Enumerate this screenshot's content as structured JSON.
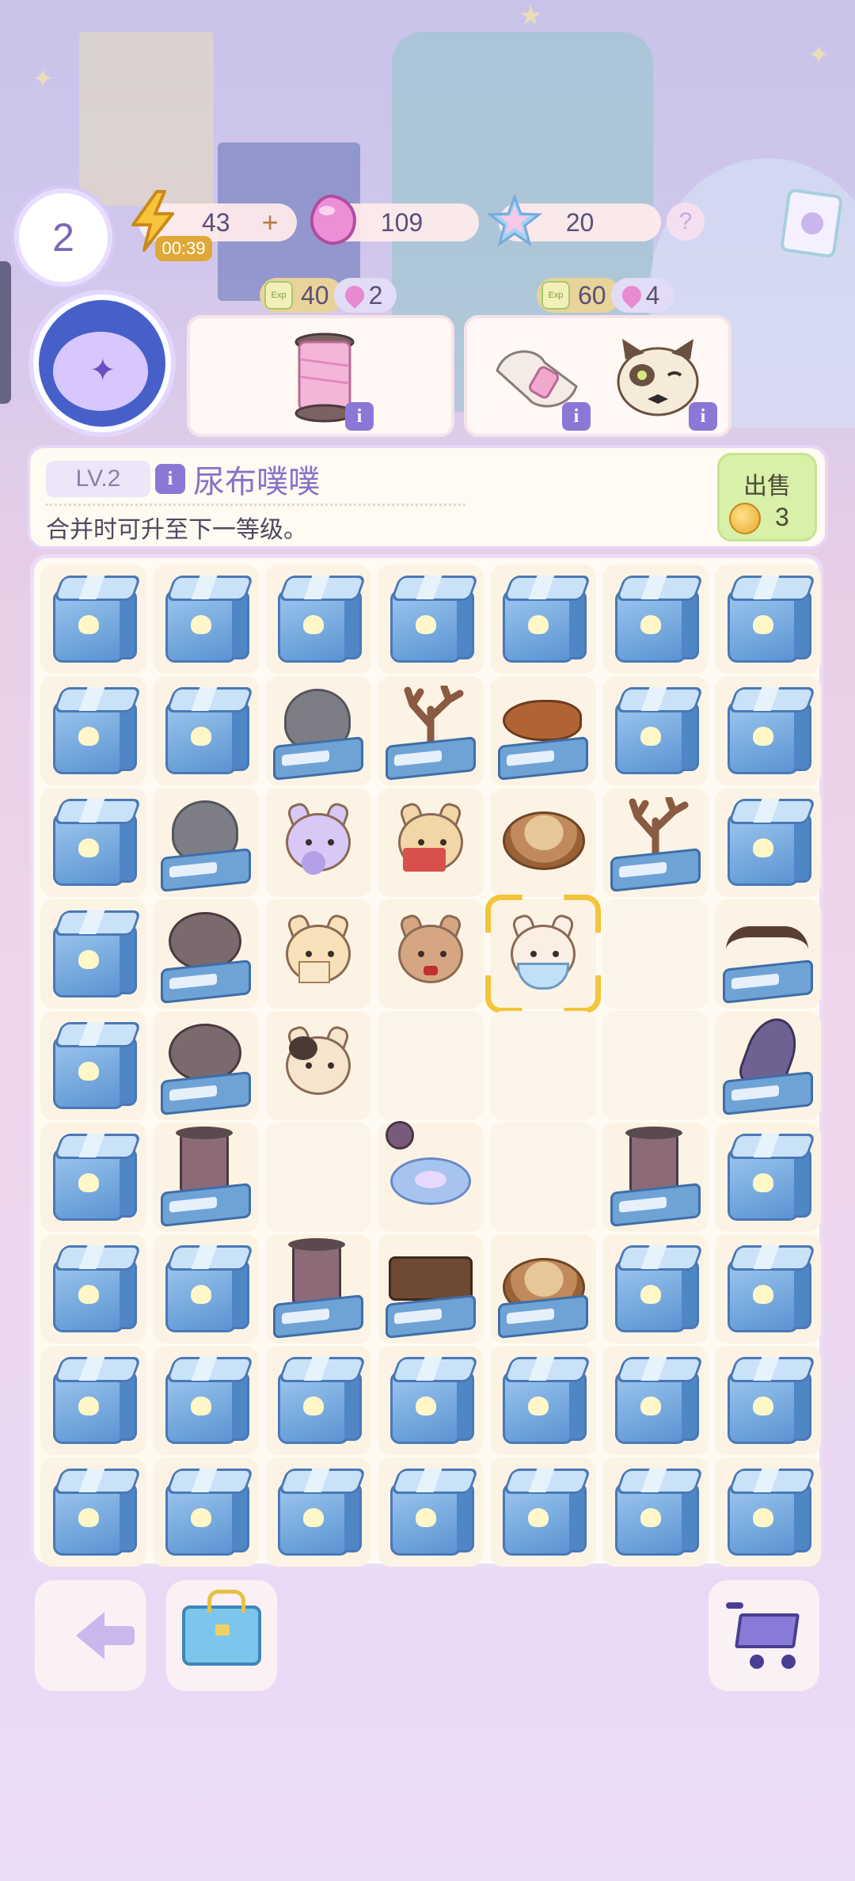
{
  "hud": {
    "level": "2",
    "energy": "43",
    "energy_plus": "+",
    "energy_timer": "00:39",
    "gems": "109",
    "stars": "20",
    "help": "?"
  },
  "orders": [
    {
      "exp": "40",
      "gem": "2",
      "exp_badge": "Exp",
      "items": [
        "pink-thread-spool"
      ]
    },
    {
      "exp": "60",
      "gem": "4",
      "exp_badge": "Exp",
      "items": [
        "thread-bundle",
        "siamese-cat"
      ]
    }
  ],
  "selected_item": {
    "level": "LV.2",
    "name": "尿布噗噗",
    "description": "合并时可升至下一等级。",
    "sell_label": "出售",
    "sell_price": "3"
  },
  "board": {
    "columns": 7,
    "rows": 9,
    "cells": [
      "crate",
      "crate",
      "crate",
      "crate",
      "crate",
      "crate",
      "crate",
      "crate",
      "crate",
      "stone-basket",
      "coral-basket",
      "fish-basket",
      "crate",
      "crate",
      "crate",
      "stone-basket",
      "cat-purple-hood",
      "hamster-book",
      "wood-log",
      "coral-basket",
      "crate",
      "crate",
      "yarn-basket",
      "cat-letter",
      "cat-brown",
      "hamster-diaper",
      "empty",
      "twig-basket",
      "crate",
      "yarn-basket",
      "cat-calico",
      "empty",
      "empty",
      "empty",
      "feather-basket",
      "crate",
      "spool-basket",
      "empty",
      "pillow-medal",
      "empty",
      "spool-basket",
      "crate",
      "crate",
      "crate",
      "spool-basket",
      "choco-basket",
      "log-basket",
      "crate",
      "crate",
      "crate",
      "crate",
      "crate",
      "crate",
      "crate",
      "crate",
      "crate",
      "crate",
      "crate",
      "crate",
      "crate",
      "crate",
      "crate",
      "crate"
    ],
    "selected_index": 25
  },
  "bottom_bar": {
    "back": "back-arrow-icon",
    "bag": "toolbox-icon",
    "shop": "cart-icon"
  },
  "colors": {
    "accent": "#8b70c8",
    "sell_green": "#d8f0a8",
    "selection_gold": "#f3c53b",
    "crate_blue": "#5a93d2"
  }
}
